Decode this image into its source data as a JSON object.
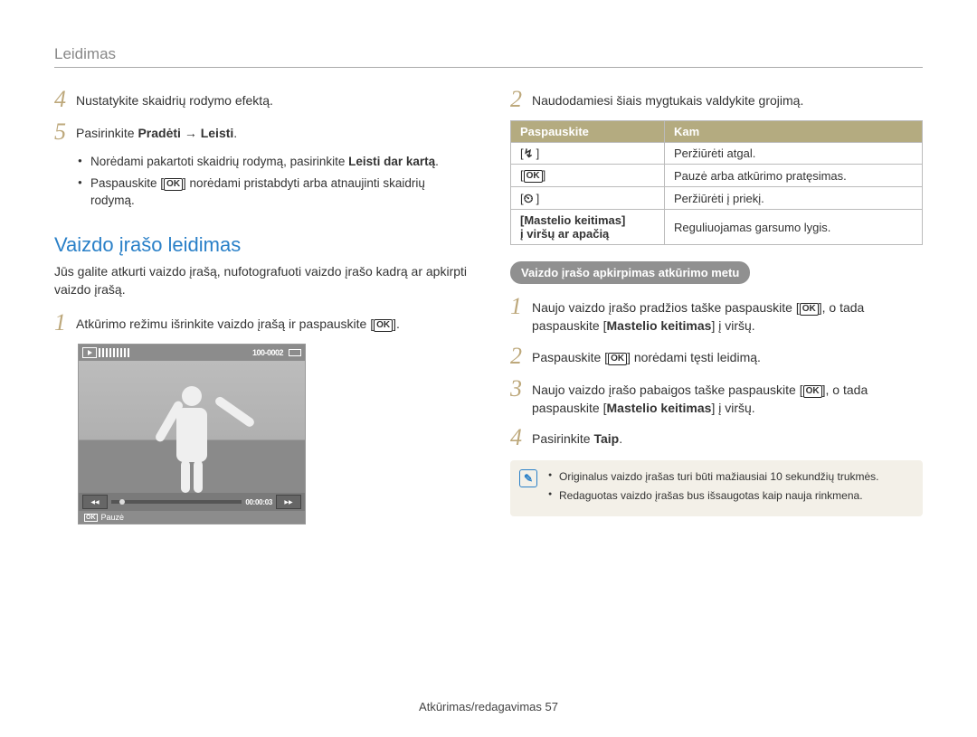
{
  "header": {
    "section": "Leidimas"
  },
  "left": {
    "step4": "Nustatykite skaidrių rodymo efektą.",
    "step5_pre": "Pasirinkite ",
    "step5_b1": "Pradėti",
    "step5_arrow": " → ",
    "step5_b2": "Leisti",
    "step5_post": ".",
    "bullet1_pre": "Norėdami pakartoti skaidrių rodymą, pasirinkite ",
    "bullet1_b": "Leisti dar kartą",
    "bullet1_post": ".",
    "bullet2_pre": "Paspauskite [",
    "bullet2_post": "] norėdami pristabdyti arba atnaujinti skaidrių rodymą.",
    "section_heading": "Vaizdo įrašo leidimas",
    "section_lead": "Jūs galite atkurti vaizdo įrašą, nufotografuoti vaizdo įrašo kadrą ar apkirpti vaizdo įrašą.",
    "step1_pre": "Atkūrimo režimu išrinkite vaizdo įrašą ir paspauskite [",
    "step1_post": "].",
    "thumb": {
      "counter": "100-0002",
      "time": "00:00:03",
      "rew": "REW",
      "ff": "FF",
      "footer_label": "Pauzė"
    }
  },
  "right": {
    "step2": "Naudodamiesi šiais mygtukais valdykite grojimą.",
    "table": {
      "h1": "Paspauskite",
      "h2": "Kam",
      "r1_btn_icon": "flash",
      "r1_txt": "Peržiūrėti atgal.",
      "r2_btn_icon": "ok",
      "r2_txt": "Pauzė arba atkūrimo pratęsimas.",
      "r3_btn_icon": "timer",
      "r3_txt": "Peržiūrėti į priekį.",
      "r4_btn_l1": "[Mastelio keitimas]",
      "r4_btn_l2": "į viršų ar apačią",
      "r4_txt": "Reguliuojamas garsumo lygis."
    },
    "subheading": "Vaizdo įrašo apkirpimas atkūrimo metu",
    "s1_pre": "Naujo vaizdo įrašo pradžios taške paspauskite [",
    "s1_mid": "], o tada paspauskite [",
    "s1_b": "Mastelio keitimas",
    "s1_post": "] į viršų.",
    "s2_pre": "Paspauskite [",
    "s2_post": "] norėdami tęsti leidimą.",
    "s3_pre": "Naujo vaizdo įrašo pabaigos taške paspauskite [",
    "s3_mid": "], o tada paspauskite [",
    "s3_b": "Mastelio keitimas",
    "s3_post": "] į viršų.",
    "s4_pre": "Pasirinkite ",
    "s4_b": "Taip",
    "s4_post": ".",
    "note1": "Originalus vaizdo įrašas turi būti mažiausiai 10 sekundžių trukmės.",
    "note2": "Redaguotas vaizdo įrašas bus išsaugotas kaip nauja rinkmena."
  },
  "footer": {
    "text": "Atkūrimas/redagavimas  57"
  },
  "ok_label": "OK"
}
